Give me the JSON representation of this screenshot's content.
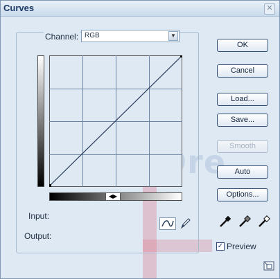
{
  "window": {
    "title": "Curves",
    "close_icon": "close-icon"
  },
  "channel": {
    "label": "Channel:",
    "value": "RGB",
    "dropdown_icon": "chevron-down-icon"
  },
  "graph": {
    "grid_divisions": 4,
    "curve_points": [
      [
        0,
        0
      ],
      [
        255,
        255
      ]
    ],
    "slider_icon": "left-right-arrows-icon"
  },
  "labels": {
    "input": "Input:",
    "output": "Output:"
  },
  "tools": {
    "curve_tool_icon": "curve-tool-icon",
    "pencil_tool_icon": "pencil-icon"
  },
  "buttons": {
    "ok": "OK",
    "cancel": "Cancel",
    "load": "Load...",
    "save": "Save...",
    "smooth": "Smooth",
    "auto": "Auto",
    "options": "Options..."
  },
  "eyedroppers": [
    "black-eyedropper-icon",
    "gray-eyedropper-icon",
    "white-eyedropper-icon"
  ],
  "preview": {
    "label": "Preview",
    "checked": true
  },
  "watermark": {
    "text": "Dre"
  },
  "colors": {
    "window_bg": "#dfe9f3",
    "button_border": "#2f4c73",
    "title_color": "#1d3a66"
  }
}
